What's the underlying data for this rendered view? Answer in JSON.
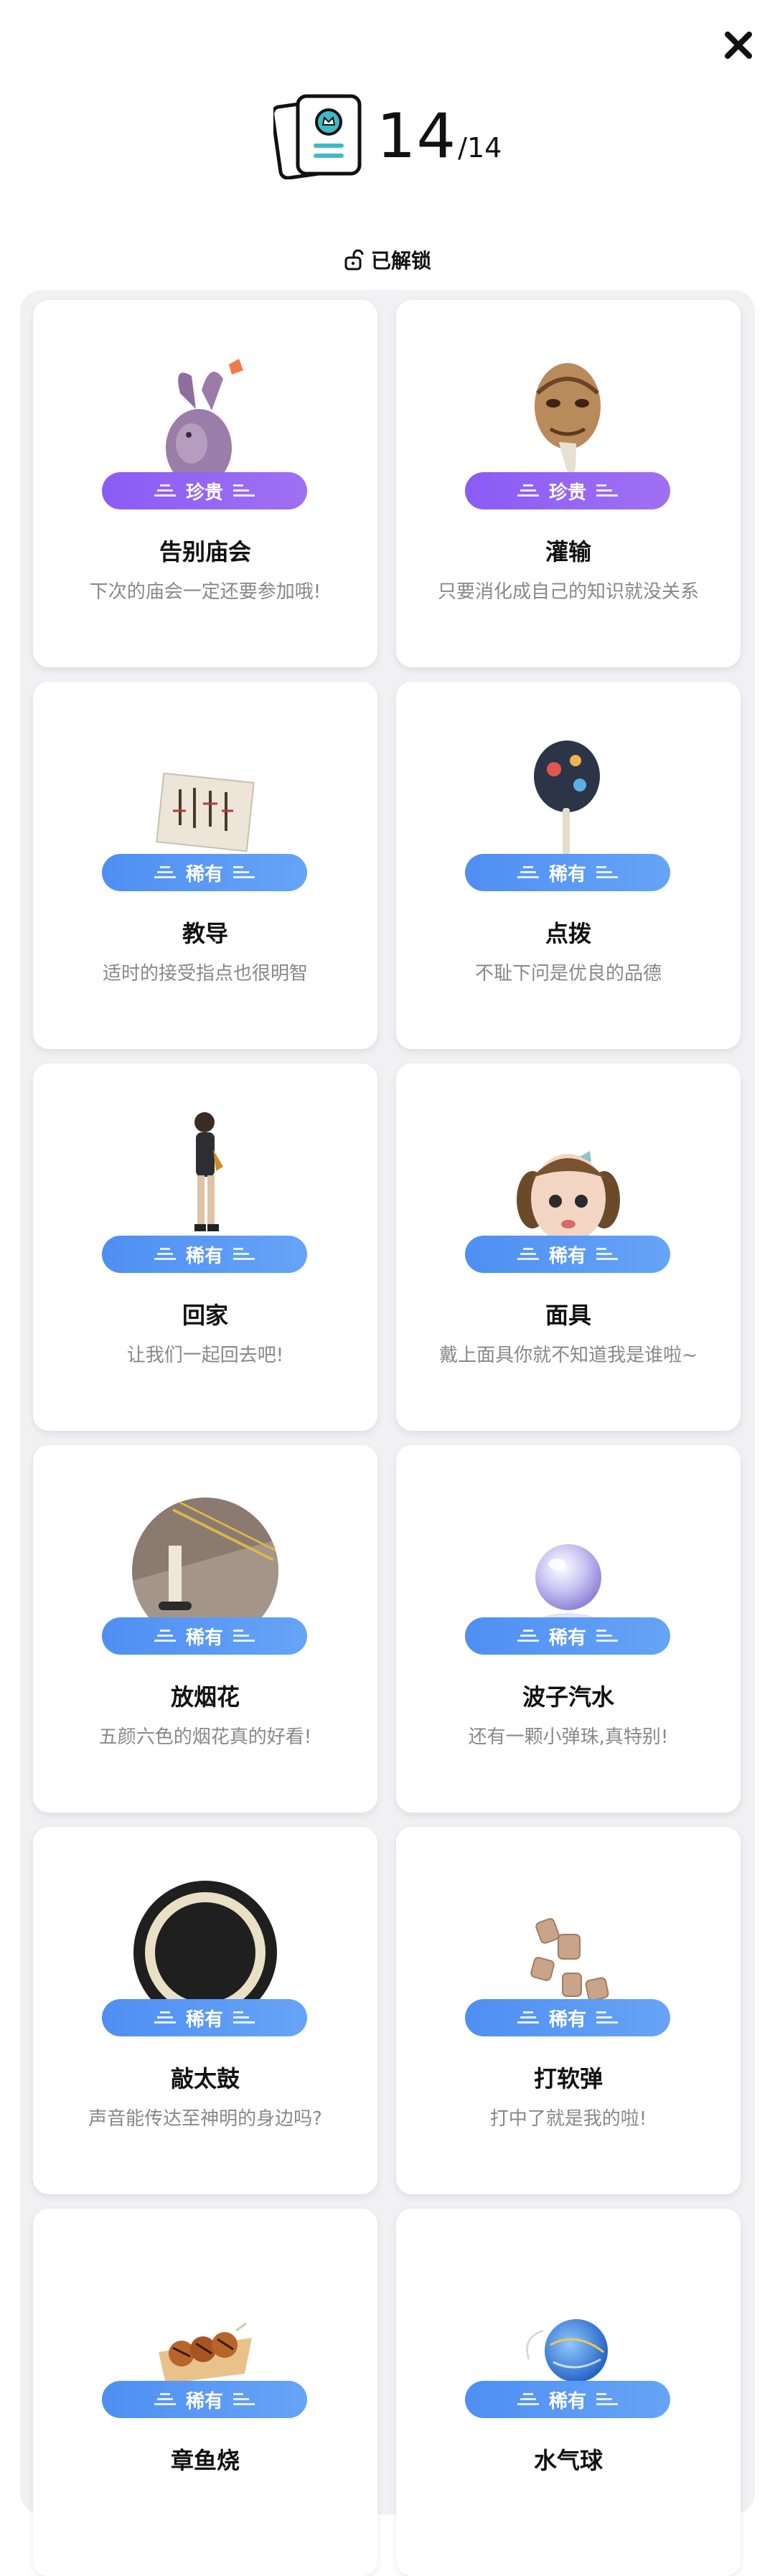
{
  "header": {
    "collected": "14",
    "total": "/14"
  },
  "filter": {
    "label": "已解锁"
  },
  "colors": {
    "precious": "#8a5cf5",
    "rare": "#5596f4",
    "panel": "#f1f1f3"
  },
  "cards": [
    {
      "rarity": "珍贵",
      "title": "告别庙会",
      "desc": "下次的庙会一定还要参加哦!",
      "icon": "purple-rabbit-icon"
    },
    {
      "rarity": "珍贵",
      "title": "灌输",
      "desc": "只要消化成自己的知识就没关系",
      "icon": "old-man-mask-icon"
    },
    {
      "rarity": "稀有",
      "title": "教导",
      "desc": "适时的接受指点也很明智",
      "icon": "calligraphy-paper-icon"
    },
    {
      "rarity": "稀有",
      "title": "点拨",
      "desc": "不耻下问是优良的品德",
      "icon": "uchiwa-fan-icon"
    },
    {
      "rarity": "稀有",
      "title": "回家",
      "desc": "让我们一起回去吧!",
      "icon": "walking-person-icon"
    },
    {
      "rarity": "稀有",
      "title": "面具",
      "desc": "戴上面具你就不知道我是谁啦~",
      "icon": "doll-mask-icon"
    },
    {
      "rarity": "稀有",
      "title": "放烟花",
      "desc": "五颜六色的烟花真的好看!",
      "icon": "sparkler-candle-icon"
    },
    {
      "rarity": "稀有",
      "title": "波子汽水",
      "desc": "还有一颗小弹珠,真特别!",
      "icon": "glass-marble-icon"
    },
    {
      "rarity": "稀有",
      "title": "敲太鼓",
      "desc": "声音能传达至神明的身边吗?",
      "icon": "taiko-drum-icon"
    },
    {
      "rarity": "稀有",
      "title": "打软弹",
      "desc": "打中了就是我的啦!",
      "icon": "cork-pellets-icon"
    },
    {
      "rarity": "稀有",
      "title": "章鱼烧",
      "desc": "",
      "icon": "takoyaki-icon"
    },
    {
      "rarity": "稀有",
      "title": "水气球",
      "desc": "",
      "icon": "water-balloon-icon"
    }
  ]
}
